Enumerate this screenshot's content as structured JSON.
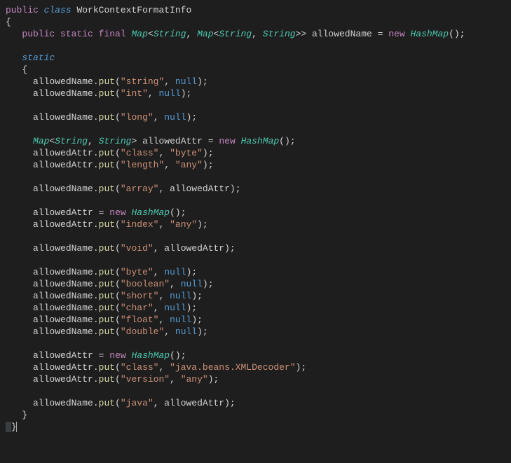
{
  "kw": {
    "public": "public",
    "class": "class",
    "static": "static",
    "final": "final",
    "new": "new",
    "null": "null"
  },
  "types": {
    "Map": "Map",
    "String": "String",
    "HashMap": "HashMap"
  },
  "names": {
    "className": "WorkContextFormatInfo",
    "allowedName": "allowedName",
    "allowedAttr": "allowedAttr",
    "put": "put"
  },
  "strings": {
    "string": "\"string\"",
    "int": "\"int\"",
    "long": "\"long\"",
    "class": "\"class\"",
    "byte": "\"byte\"",
    "length": "\"length\"",
    "any": "\"any\"",
    "array": "\"array\"",
    "index": "\"index\"",
    "void": "\"void\"",
    "boolean": "\"boolean\"",
    "short": "\"short\"",
    "char": "\"char\"",
    "float": "\"float\"",
    "double": "\"double\"",
    "version": "\"version\"",
    "java": "\"java\"",
    "xmlDecoder": "\"java.beans.XMLDecoder\""
  }
}
